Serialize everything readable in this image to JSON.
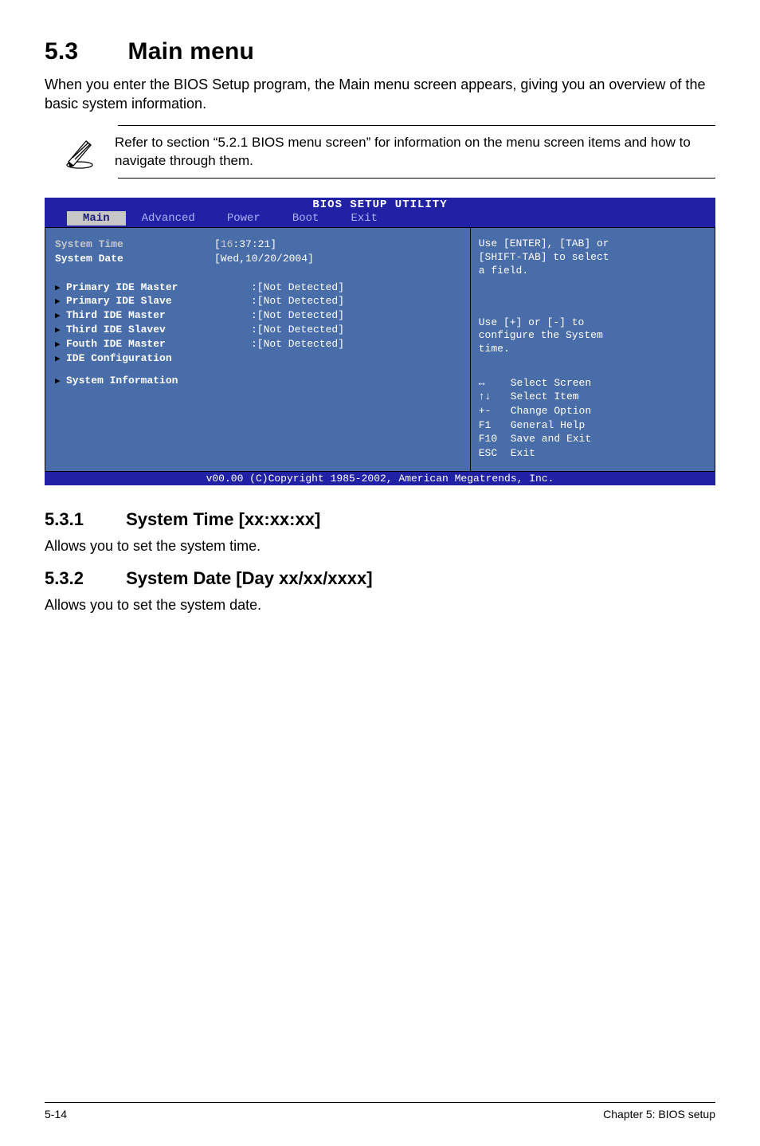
{
  "section": {
    "number": "5.3",
    "title": "Main menu",
    "intro": "When you enter the BIOS Setup program, the Main menu screen appears, giving you an overview of the basic system information."
  },
  "note": {
    "text": "Refer to section “5.2.1  BIOS menu screen” for information on the menu screen items and how to navigate through them."
  },
  "bios": {
    "title": "BIOS SETUP UTILITY",
    "tabs": [
      "Main",
      "Advanced",
      "Power",
      "Boot",
      "Exit"
    ],
    "active_tab": "Main",
    "left": {
      "system_time_label": "System Time",
      "system_time_value_prefix": "[",
      "system_time_value_hour": "16",
      "system_time_value_rest": ":37:21]",
      "system_date_label": "System Date",
      "system_date_value": "[Wed,10/20/2004]",
      "items": [
        {
          "label": "Primary IDE Master",
          "value": ":[Not Detected]"
        },
        {
          "label": "Primary IDE Slave",
          "value": ":[Not Detected]"
        },
        {
          "label": "Third IDE Master",
          "value": ":[Not Detected]"
        },
        {
          "label": "Third IDE Slavev",
          "value": ":[Not Detected]"
        },
        {
          "label": "Fouth IDE Master",
          "value": ":[Not Detected]"
        },
        {
          "label": "IDE Configuration",
          "value": ""
        },
        {
          "label": "System Information",
          "value": ""
        }
      ]
    },
    "right": {
      "help_top": "Use [ENTER], [TAB] or\n[SHIFT-TAB] to select\na field.",
      "help_sys": "Use [+] or [-] to\nconfigure the System\ntime.",
      "keys": [
        {
          "sym": "↔",
          "desc": "Select Screen"
        },
        {
          "sym": "↑↓",
          "desc": "Select Item"
        },
        {
          "sym": "+-",
          "desc": "Change Option"
        },
        {
          "sym": "F1",
          "desc": "General Help"
        },
        {
          "sym": "F10",
          "desc": "Save and Exit"
        },
        {
          "sym": "ESC",
          "desc": "Exit"
        }
      ]
    },
    "footer": "v00.00 (C)Copyright 1985-2002, American Megatrends, Inc."
  },
  "subsections": [
    {
      "num": "5.3.1",
      "title": "System Time [xx:xx:xx]",
      "body": "Allows you to set the system time."
    },
    {
      "num": "5.3.2",
      "title": "System Date [Day xx/xx/xxxx]",
      "body": "Allows you to set the system date."
    }
  ],
  "footer": {
    "left": "5-14",
    "right": "Chapter 5: BIOS setup"
  }
}
